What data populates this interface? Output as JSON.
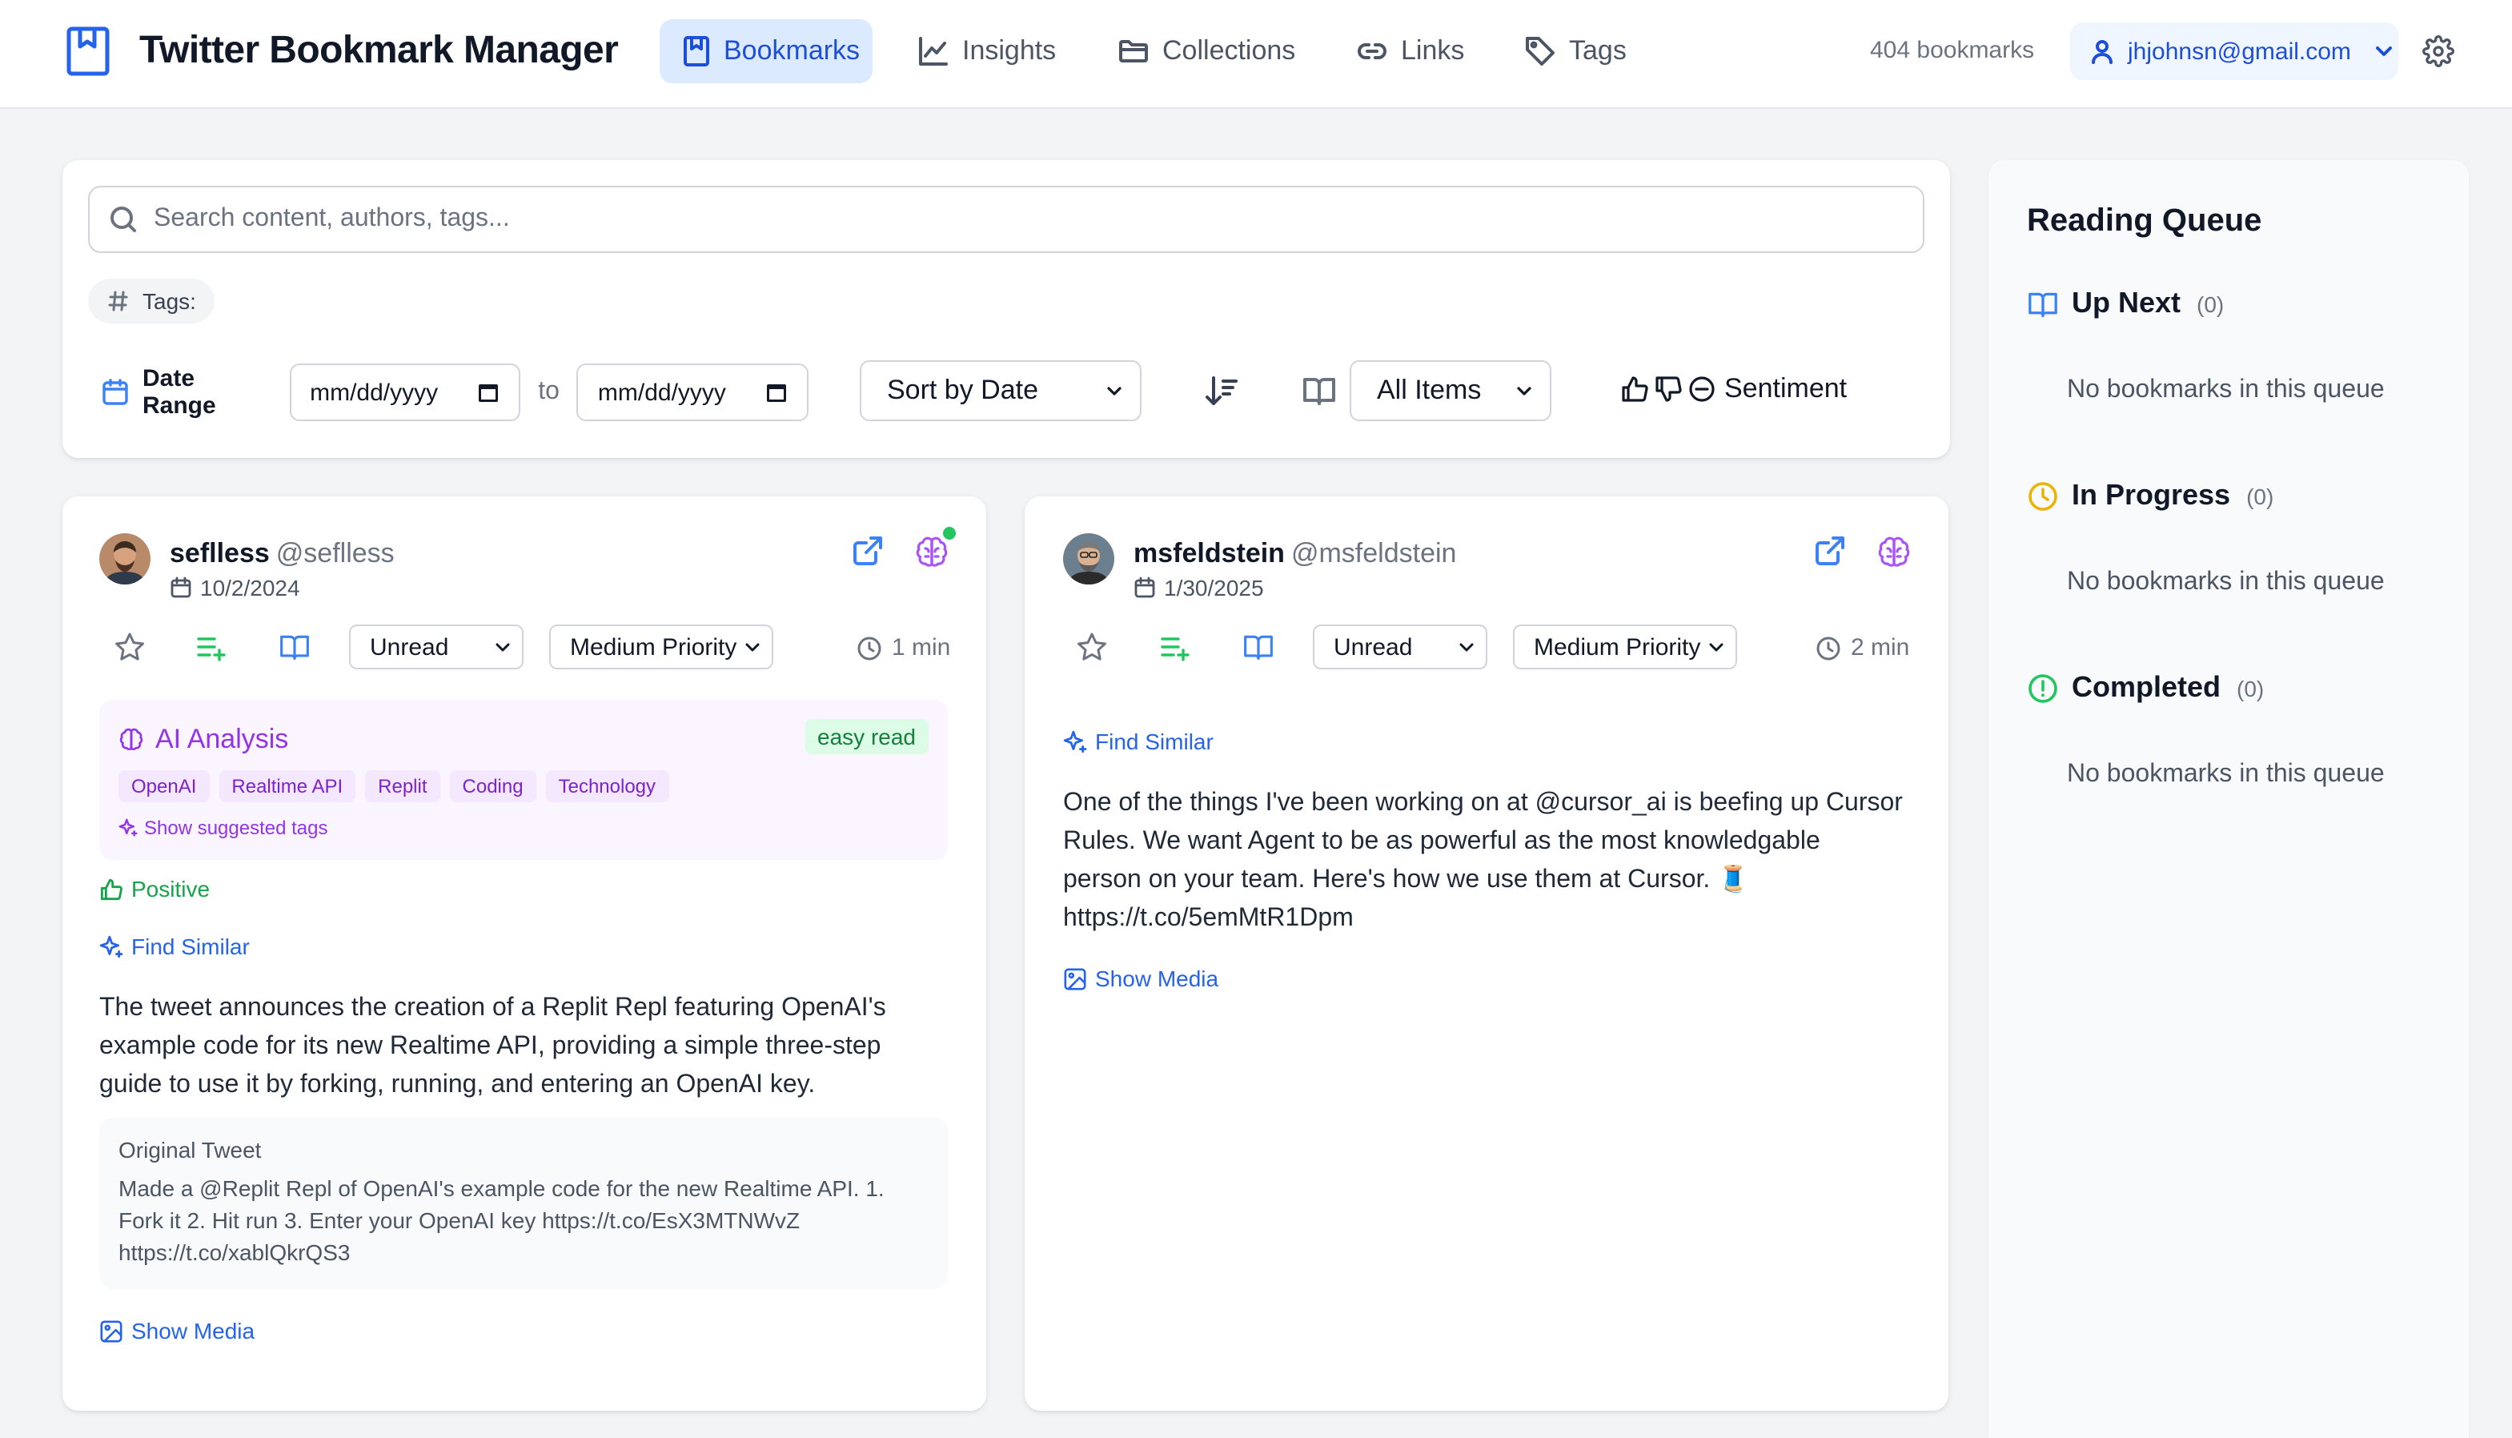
{
  "app": {
    "title": "Twitter Bookmark Manager",
    "accent": "#2563eb"
  },
  "nav": {
    "items": [
      {
        "label": "Bookmarks",
        "icon": "bookmark-icon",
        "active": true
      },
      {
        "label": "Insights",
        "icon": "line-chart-icon"
      },
      {
        "label": "Collections",
        "icon": "folder-icon"
      },
      {
        "label": "Links",
        "icon": "link-icon"
      },
      {
        "label": "Tags",
        "icon": "tag-icon"
      }
    ]
  },
  "header": {
    "bookmark_count": "404 bookmarks",
    "user_email": "jhjohnsn@gmail.com"
  },
  "filters": {
    "search_placeholder": "Search content, authors, tags...",
    "tags_label": "Tags:",
    "date_range_label": "Date Range",
    "date_from": "mm/dd/yyyy",
    "to_label": "to",
    "date_to": "mm/dd/yyyy",
    "sort": "Sort by Date",
    "items_filter": "All Items",
    "sentiment_label": "Sentiment"
  },
  "cards": [
    {
      "name": "seflless",
      "handle": "@seflless",
      "date": "10/2/2024",
      "status": "Unread",
      "priority": "Medium Priority",
      "read_time": "1 min",
      "ai": {
        "title": "AI Analysis",
        "difficulty": "easy read",
        "tags": [
          "OpenAI",
          "Realtime API",
          "Replit",
          "Coding",
          "Technology"
        ],
        "suggested_label": "Show suggested tags"
      },
      "sentiment": "Positive",
      "find_similar": "Find Similar",
      "summary": "The tweet announces the creation of a Replit Repl featuring OpenAI's example code for its new Realtime API, providing a simple three-step guide to use it by forking, running, and entering an OpenAI key.",
      "original_label": "Original Tweet",
      "original_text": "Made a @Replit Repl of OpenAI's example code for the new Realtime API. 1. Fork it 2. Hit run 3. Enter your OpenAI key https://t.co/EsX3MTNWvZ https://t.co/xablQkrQS3",
      "show_media": "Show Media"
    },
    {
      "name": "msfeldstein",
      "handle": "@msfeldstein",
      "date": "1/30/2025",
      "status": "Unread",
      "priority": "Medium Priority",
      "read_time": "2 min",
      "find_similar": "Find Similar",
      "text": "One of the things I've been working on at @cursor_ai is beefing up Cursor Rules. We want Agent to be as powerful as the most knowledgable person on your team. Here's how we use them at Cursor. 🧵 https://t.co/5emMtR1Dpm",
      "show_media": "Show Media"
    }
  ],
  "queue": {
    "title": "Reading Queue",
    "sections": [
      {
        "label": "Up Next",
        "count": "(0)",
        "empty": "No bookmarks in this queue",
        "color": "#3b82f6"
      },
      {
        "label": "In Progress",
        "count": "(0)",
        "empty": "No bookmarks in this queue",
        "color": "#eab308"
      },
      {
        "label": "Completed",
        "count": "(0)",
        "empty": "No bookmarks in this queue",
        "color": "#22c55e"
      }
    ]
  }
}
